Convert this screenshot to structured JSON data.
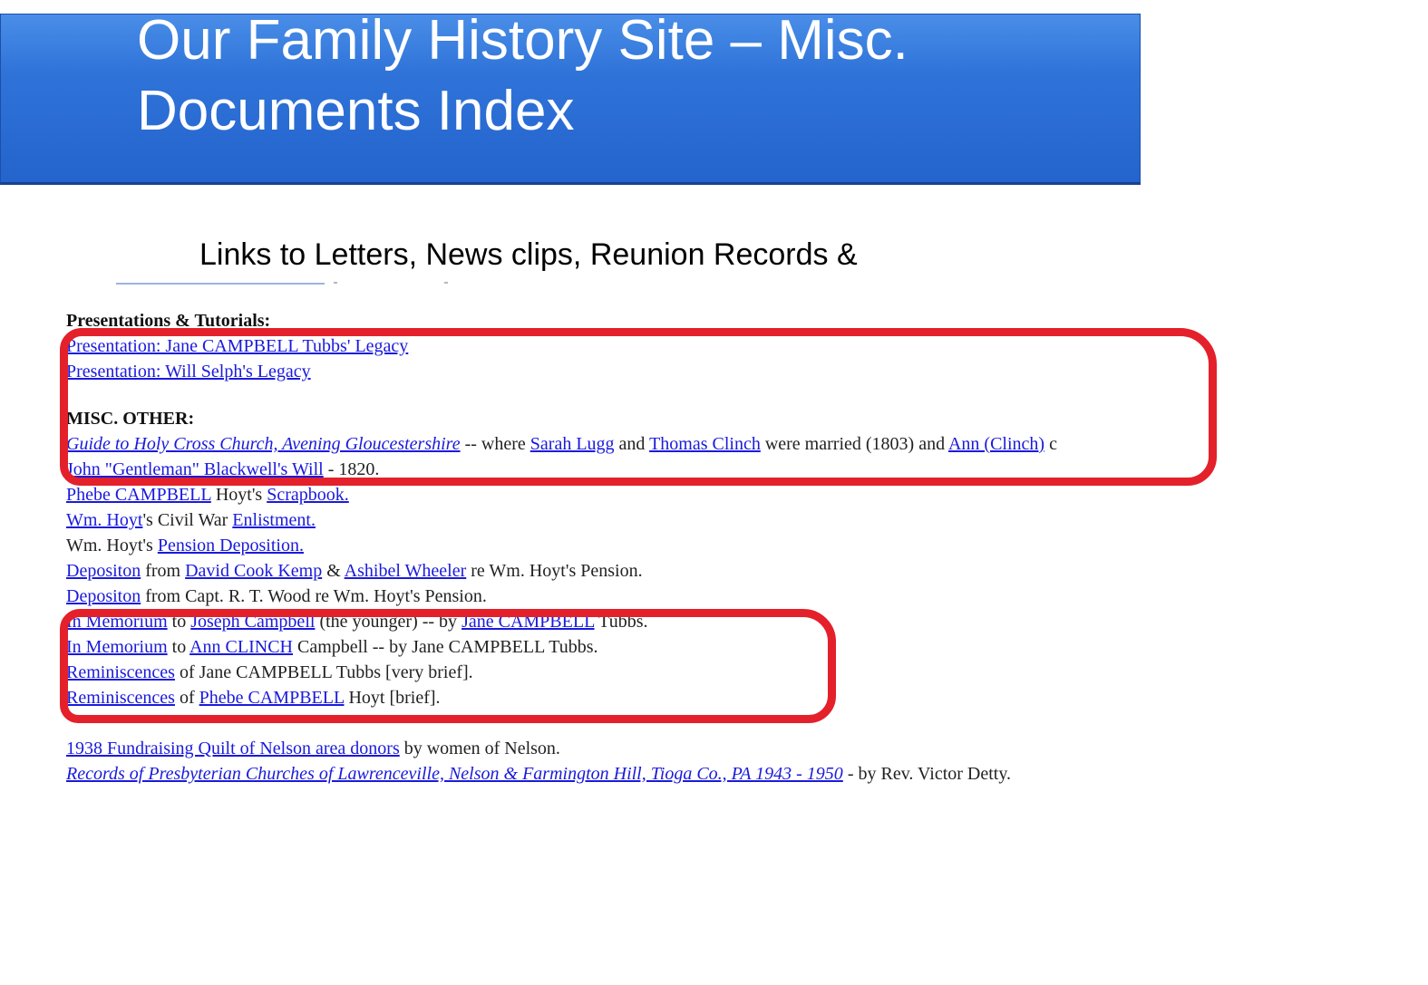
{
  "slide": {
    "title": "Our Family History Site – Misc.\nDocuments Index",
    "subtitle": "Links to Letters, News clips, Reunion Records &"
  },
  "doc": {
    "presentations_heading": "Presentations & Tutorials:",
    "presentation_1": "Presentation: Jane CAMPBELL Tubbs' Legacy",
    "presentation_2": "Presentation: Will Selph's Legacy",
    "misc_heading": "MISC. OTHER:",
    "guide": {
      "link": "Guide to Holy Cross Church, Avening Gloucestershire",
      "t1": " -- where ",
      "l2": "Sarah Lugg",
      "t2": " and ",
      "l3": "Thomas Clinch",
      "t3": " were married (1803) and ",
      "l4": "Ann (Clinch)",
      "t4": " c"
    },
    "will": {
      "link": "John \"Gentleman\" Blackwell's Will",
      "t1": " - 1820."
    },
    "scrapbook": {
      "l1": "Phebe CAMPBELL",
      "t1": " Hoyt's ",
      "l2": "Scrapbook."
    },
    "enlistment": {
      "l1": "Wm. Hoyt",
      "t1": "'s Civil War ",
      "l2": "Enlistment."
    },
    "pension": {
      "t1": "Wm. Hoyt's ",
      "l1": "Pension Deposition."
    },
    "depo1": {
      "l1": "Depositon",
      "t1": " from ",
      "l2": "David Cook Kemp",
      "t2": " & ",
      "l3": "Ashibel Wheeler",
      "t3": " re Wm. Hoyt's Pension."
    },
    "depo2": {
      "l1": "Depositon",
      "t1": " from Capt. R. T. Wood re Wm. Hoyt's Pension."
    },
    "memorium1": {
      "l1": "In Memorium",
      "t1": " to ",
      "l2": "Joseph Campbell",
      "t2": " (the younger) -- by ",
      "l3": "Jane CAMPBELL",
      "t3": " Tubbs."
    },
    "memorium2": {
      "l1": "In Memorium",
      "t1": " to ",
      "l2": "Ann CLINCH",
      "t2": " Campbell  -- by Jane CAMPBELL Tubbs."
    },
    "remin1": {
      "l1": "Reminiscences",
      "t1": " of Jane CAMPBELL Tubbs [very brief]."
    },
    "remin2": {
      "l1": "Reminiscences",
      "t1": " of ",
      "l2": "Phebe CAMPBELL",
      "t2": " Hoyt [brief]."
    },
    "quilt": {
      "l1": "1938 Fundraising Quilt of Nelson area donors",
      "t1": " by women of Nelson."
    },
    "records": {
      "l1": "Records of Presbyterian Churches of Lawrenceville, Nelson & Farmington Hill, Tioga Co., PA 1943 - 1950",
      "t1": " - by Rev. Victor Detty."
    }
  },
  "colors": {
    "title_bar": "#2f73d9",
    "link": "#1a1adc",
    "annotation": "#e4202b"
  }
}
